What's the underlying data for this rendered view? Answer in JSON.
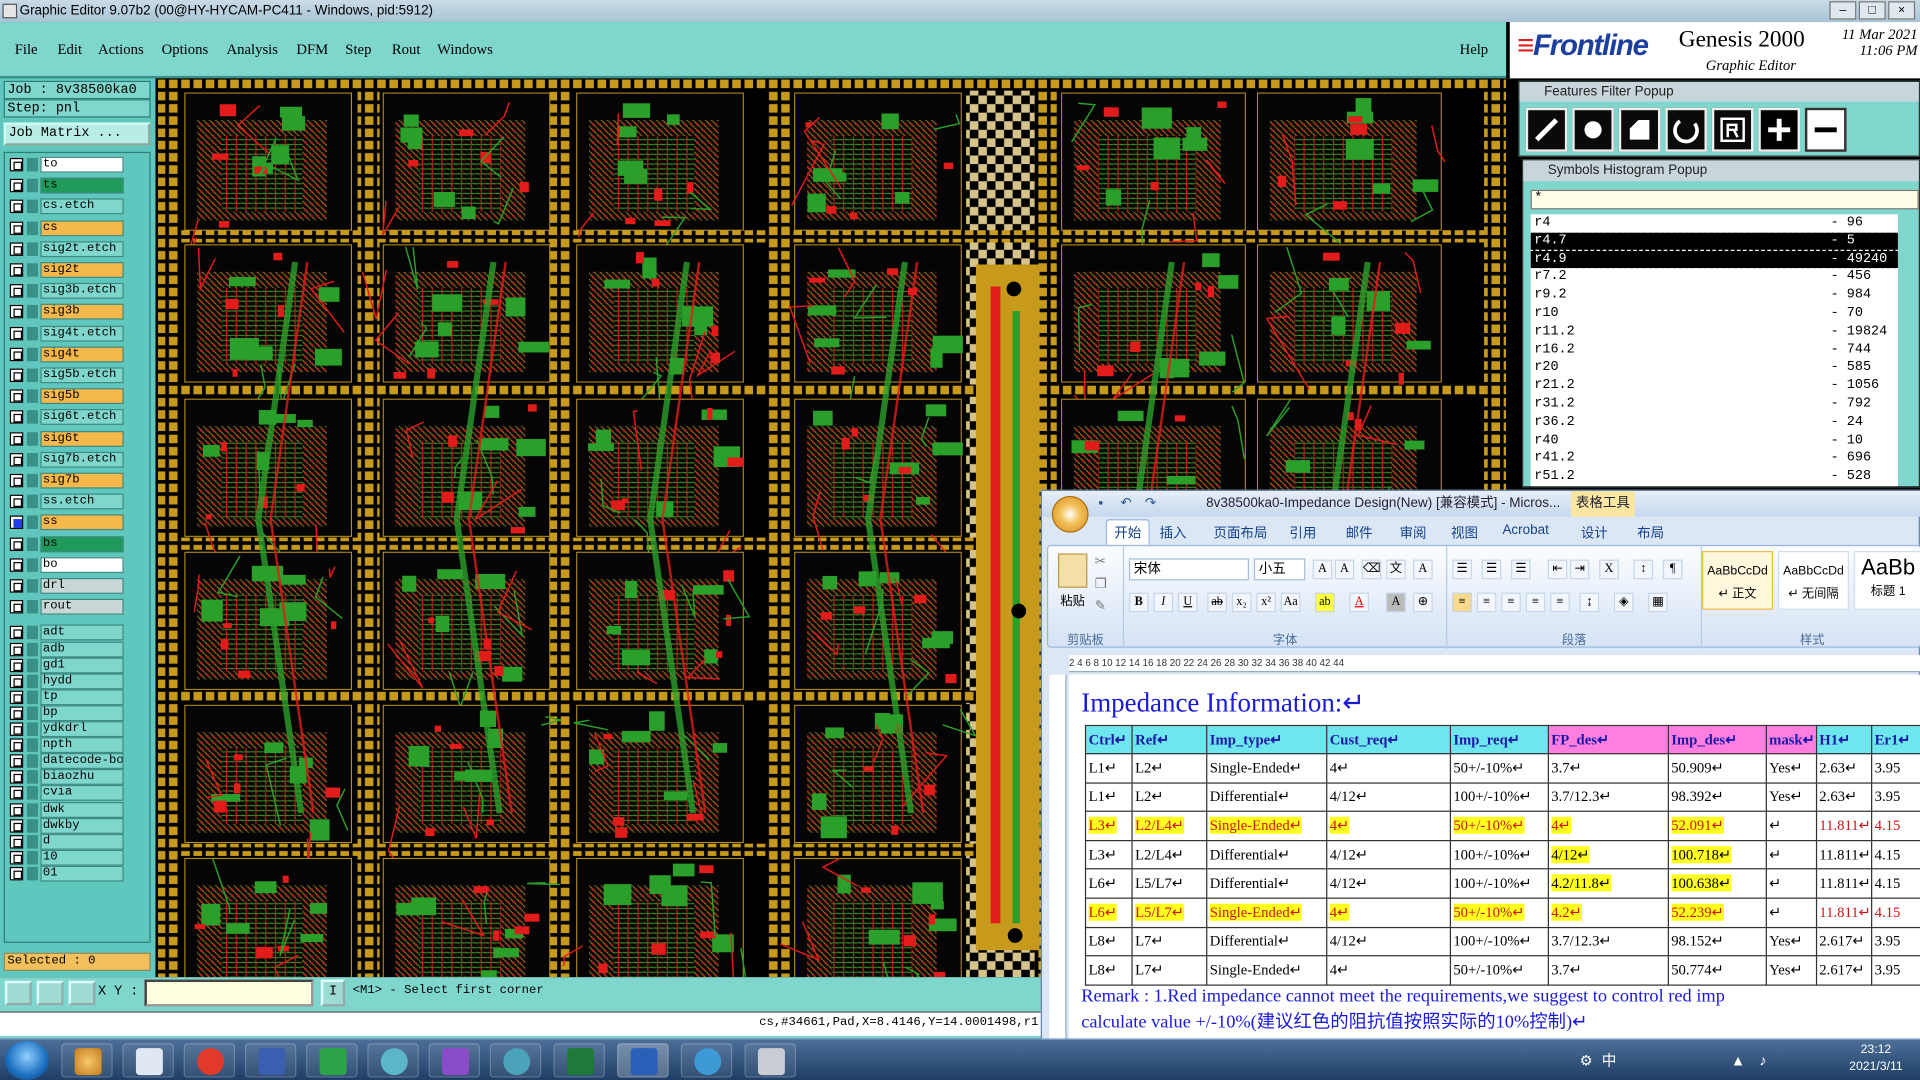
{
  "window": {
    "title": "Graphic Editor 9.07b2 (00@HY-HYCAM-PC411 - Windows, pid:5912)"
  },
  "menu": [
    {
      "id": "file",
      "label": "File"
    },
    {
      "id": "edit",
      "label": "Edit"
    },
    {
      "id": "actions",
      "label": "Actions"
    },
    {
      "id": "options",
      "label": "Options"
    },
    {
      "id": "analysis",
      "label": "Analysis"
    },
    {
      "id": "dfm",
      "label": "DFM"
    },
    {
      "id": "step",
      "label": "Step"
    },
    {
      "id": "rout",
      "label": "Rout"
    },
    {
      "id": "windows",
      "label": "Windows"
    }
  ],
  "help_label": "Help",
  "brand": {
    "logo": "Frontline",
    "product": "Genesis 2000",
    "subtitle": "Graphic Editor",
    "date": "11 Mar 2021",
    "time": "11:06 PM"
  },
  "left": {
    "job": "Job : 8v38500ka0",
    "step": "Step: pnl",
    "job_matrix": "Job Matrix ...",
    "selected": "Selected : 0"
  },
  "layers": [
    {
      "name": "to",
      "color": "#ffffff",
      "active": false
    },
    {
      "name": "ts",
      "color": "#1f9a5a",
      "active": false
    },
    {
      "name": "cs.etch",
      "color": "#7fd6cc",
      "active": false
    },
    {
      "name": "cs",
      "color": "#f5b84b",
      "active": false
    },
    {
      "name": "sig2t.etch",
      "color": "#7fd6cc",
      "active": false
    },
    {
      "name": "sig2t",
      "color": "#f5b84b",
      "active": false
    },
    {
      "name": "sig3b.etch",
      "color": "#7fd6cc",
      "active": false
    },
    {
      "name": "sig3b",
      "color": "#f5b84b",
      "active": false
    },
    {
      "name": "sig4t.etch",
      "color": "#7fd6cc",
      "active": false
    },
    {
      "name": "sig4t",
      "color": "#f5b84b",
      "active": false
    },
    {
      "name": "sig5b.etch",
      "color": "#7fd6cc",
      "active": false
    },
    {
      "name": "sig5b",
      "color": "#f5b84b",
      "active": false
    },
    {
      "name": "sig6t.etch",
      "color": "#7fd6cc",
      "active": false
    },
    {
      "name": "sig6t",
      "color": "#f5b84b",
      "active": false
    },
    {
      "name": "sig7b.etch",
      "color": "#7fd6cc",
      "active": false
    },
    {
      "name": "sig7b",
      "color": "#f5b84b",
      "active": false
    },
    {
      "name": "ss.etch",
      "color": "#7fd6cc",
      "active": false
    },
    {
      "name": "ss",
      "color": "#f5b84b",
      "active": true
    },
    {
      "name": "bs",
      "color": "#1f9a5a",
      "active": false
    },
    {
      "name": "bo",
      "color": "#ffffff",
      "active": false
    },
    {
      "name": "drl",
      "color": "#c9d6d6",
      "active": false
    },
    {
      "name": "rout",
      "color": "#c9d6d6",
      "active": false
    },
    {
      "name": "adt",
      "color": "#7fd6cc",
      "active": false
    },
    {
      "name": "adb",
      "color": "#7fd6cc",
      "active": false
    },
    {
      "name": "gd1",
      "color": "#7fd6cc",
      "active": false
    },
    {
      "name": "hydd",
      "color": "#7fd6cc",
      "active": false
    },
    {
      "name": "tp",
      "color": "#7fd6cc",
      "active": false
    },
    {
      "name": "bp",
      "color": "#7fd6cc",
      "active": false
    },
    {
      "name": "ydkdrl",
      "color": "#7fd6cc",
      "active": false
    },
    {
      "name": "npth",
      "color": "#7fd6cc",
      "active": false
    },
    {
      "name": "datecode-bo",
      "color": "#7fd6cc",
      "active": false
    },
    {
      "name": "biaozhu",
      "color": "#7fd6cc",
      "active": false
    },
    {
      "name": "cvia",
      "color": "#7fd6cc",
      "active": false
    },
    {
      "name": "dwk",
      "color": "#7fd6cc",
      "active": false
    },
    {
      "name": "dwkby",
      "color": "#7fd6cc",
      "active": false
    },
    {
      "name": "d",
      "color": "#7fd6cc",
      "active": false
    },
    {
      "name": "10",
      "color": "#7fd6cc",
      "active": false
    },
    {
      "name": "01",
      "color": "#7fd6cc",
      "active": false
    }
  ],
  "bottom": {
    "xy_label": "X Y :",
    "i_button": "I",
    "message": "<M1> - Select first corner",
    "coords": "cs,#34661,Pad,X=8.4146,Y=14.0001498,r1"
  },
  "features_popup": {
    "title": "Features Filter Popup"
  },
  "histogram": {
    "title": "Symbols Histogram Popup",
    "filter": "*",
    "rows": [
      {
        "sym": "r4",
        "count": "- 96",
        "sel": false
      },
      {
        "sym": "r4.7",
        "count": "- 5",
        "sel": true
      },
      {
        "sym": "r4.9",
        "count": "- 49240",
        "sel": true
      },
      {
        "sym": "r7.2",
        "count": "- 456",
        "sel": false
      },
      {
        "sym": "r9.2",
        "count": "- 984",
        "sel": false
      },
      {
        "sym": "r10",
        "count": "- 70",
        "sel": false
      },
      {
        "sym": "r11.2",
        "count": "- 19824",
        "sel": false
      },
      {
        "sym": "r16.2",
        "count": "- 744",
        "sel": false
      },
      {
        "sym": "r20",
        "count": "- 585",
        "sel": false
      },
      {
        "sym": "r21.2",
        "count": "- 1056",
        "sel": false
      },
      {
        "sym": "r31.2",
        "count": "- 792",
        "sel": false
      },
      {
        "sym": "r36.2",
        "count": "- 24",
        "sel": false
      },
      {
        "sym": "r40",
        "count": "- 10",
        "sel": false
      },
      {
        "sym": "r41.2",
        "count": "- 696",
        "sel": false
      },
      {
        "sym": "r51.2",
        "count": "- 528",
        "sel": false
      }
    ]
  },
  "word": {
    "title": "8v38500ka0-Impedance Design(New) [兼容模式] - Micros...",
    "context_tab": "表格工具",
    "tabs": [
      "开始",
      "插入",
      "页面布局",
      "引用",
      "邮件",
      "审阅",
      "视图",
      "Acrobat",
      "设计",
      "布局"
    ],
    "groups": {
      "clipboard": "剪贴板",
      "paste": "粘贴",
      "font": "字体",
      "paragraph": "段落",
      "styles": "样式"
    },
    "font_name": "宋体",
    "font_size": "小五",
    "styles": [
      {
        "sample": "AaBbCcDd",
        "name": "↵ 正文"
      },
      {
        "sample": "AaBbCcDd",
        "name": "↵ 无间隔"
      },
      {
        "sample": "AaBb",
        "name": "标题 1"
      }
    ],
    "ruler": "  2  4  6  8  10  12  14  16  18  20  22  24  26  28  30  32  34  36  38  40  42  44",
    "doc_title": "Impedance Information:↵",
    "table": {
      "headers": [
        "Ctrl↵",
        "Ref↵",
        "Imp_type↵",
        "Cust_req↵",
        "Imp_req↵",
        "FP_des↵",
        "Imp_des↵",
        "mask↵",
        "H1↵",
        "Er1↵"
      ],
      "rows": [
        {
          "hl": false,
          "red": false,
          "cells": [
            "L1↵",
            "L2↵",
            "Single-Ended↵",
            "4↵",
            "50+/-10%↵",
            "3.7↵",
            "50.909↵",
            "Yes↵",
            "2.63↵",
            "3.95"
          ]
        },
        {
          "hl": false,
          "red": false,
          "cells": [
            "L1↵",
            "L2↵",
            "Differential↵",
            "4/12↵",
            "100+/-10%↵",
            "3.7/12.3↵",
            "98.392↵",
            "Yes↵",
            "2.63↵",
            "3.95"
          ]
        },
        {
          "hl": true,
          "red": true,
          "cells": [
            "L3↵",
            "L2/L4↵",
            "Single-Ended↵",
            "4↵",
            "50+/-10%↵",
            "4↵",
            "52.091↵",
            "↵",
            "11.811↵",
            "4.15"
          ]
        },
        {
          "hl": true,
          "red": false,
          "cells": [
            "L3↵",
            "L2/L4↵",
            "Differential↵",
            "4/12↵",
            "100+/-10%↵",
            "4/12↵",
            "100.718↵",
            "↵",
            "11.811↵",
            "4.15"
          ]
        },
        {
          "hl": true,
          "red": false,
          "cells": [
            "L6↵",
            "L5/L7↵",
            "Differential↵",
            "4/12↵",
            "100+/-10%↵",
            "4.2/11.8↵",
            "100.638↵",
            "↵",
            "11.811↵",
            "4.15"
          ]
        },
        {
          "hl": true,
          "red": true,
          "cells": [
            "L6↵",
            "L5/L7↵",
            "Single-Ended↵",
            "4↵",
            "50+/-10%↵",
            "4.2↵",
            "52.239↵",
            "↵",
            "11.811↵",
            "4.15"
          ]
        },
        {
          "hl": false,
          "red": false,
          "cells": [
            "L8↵",
            "L7↵",
            "Differential↵",
            "4/12↵",
            "100+/-10%↵",
            "3.7/12.3↵",
            "98.152↵",
            "Yes↵",
            "2.617↵",
            "3.95"
          ]
        },
        {
          "hl": false,
          "red": false,
          "cells": [
            "L8↵",
            "L7↵",
            "Single-Ended↵",
            "4↵",
            "50+/-10%↵",
            "3.7↵",
            "50.774↵",
            "Yes↵",
            "2.617↵",
            "3.95"
          ]
        }
      ]
    },
    "remark1": "Remark : 1.Red impedance cannot meet the requirements,we suggest to control red imp",
    "remark2": "calculate value +/-10%(建议红色的阻抗值按照实际的10%控制)↵"
  },
  "taskbar": {
    "tray_text": "中",
    "time": "23:12",
    "date": "2021/3/11"
  },
  "colors": {
    "accent": "#7fd6cc",
    "pcb_green": "#1f9a1f",
    "pcb_red": "#e21b1b",
    "pcb_gold": "#c79a1c",
    "highlight": "#ffff20",
    "word_blue": "#1a1adc"
  }
}
